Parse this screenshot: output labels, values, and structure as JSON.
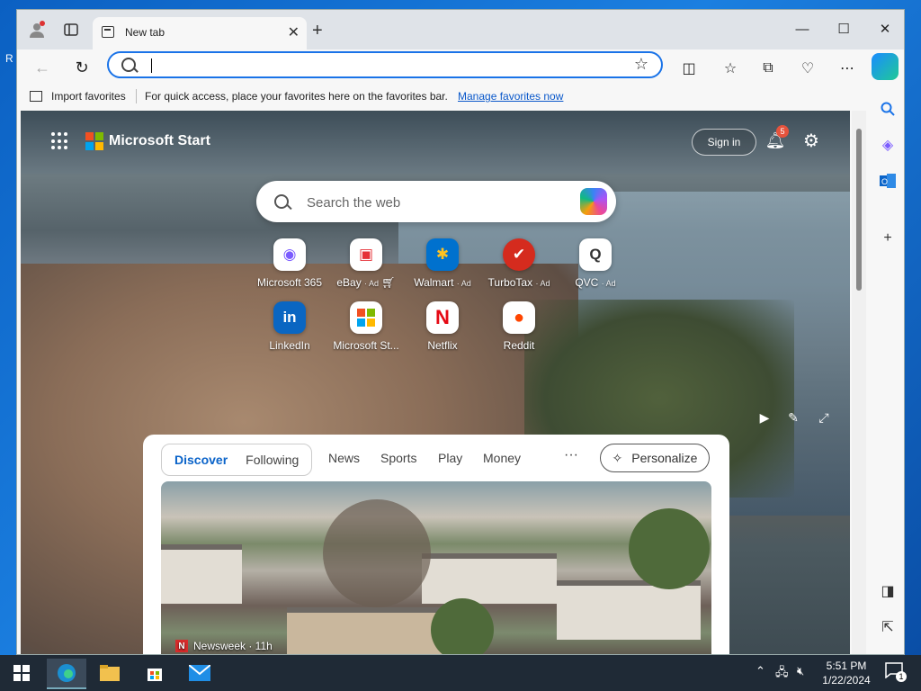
{
  "desktop": {
    "label": "R"
  },
  "browser": {
    "tab_title": "New tab",
    "address_placeholder": "",
    "favorites_bar": {
      "import": "Import favorites",
      "hint": "For quick access, place your favorites here on the favorites bar.",
      "manage": "Manage favorites now"
    }
  },
  "start": {
    "brand": "Microsoft Start",
    "sign_in": "Sign in",
    "notifications": "5",
    "search_placeholder": "Search the web",
    "quick_links": [
      {
        "label": "Microsoft 365",
        "ad": ""
      },
      {
        "label": "eBay",
        "ad": "· Ad"
      },
      {
        "label": "Walmart",
        "ad": "· Ad"
      },
      {
        "label": "TurboTax",
        "ad": "· Ad"
      },
      {
        "label": "QVC",
        "ad": "· Ad"
      },
      {
        "label": "LinkedIn",
        "ad": ""
      },
      {
        "label": "Microsoft St...",
        "ad": ""
      },
      {
        "label": "Netflix",
        "ad": ""
      },
      {
        "label": "Reddit",
        "ad": ""
      }
    ],
    "feed": {
      "tabs": [
        "Discover",
        "Following"
      ],
      "nav": [
        "News",
        "Sports",
        "Play",
        "Money"
      ],
      "more": "···",
      "personalize": "Personalize",
      "article_source": "Newsweek · 11h"
    }
  },
  "taskbar": {
    "time": "5:51 PM",
    "date": "1/22/2024",
    "notif_count": "1"
  }
}
